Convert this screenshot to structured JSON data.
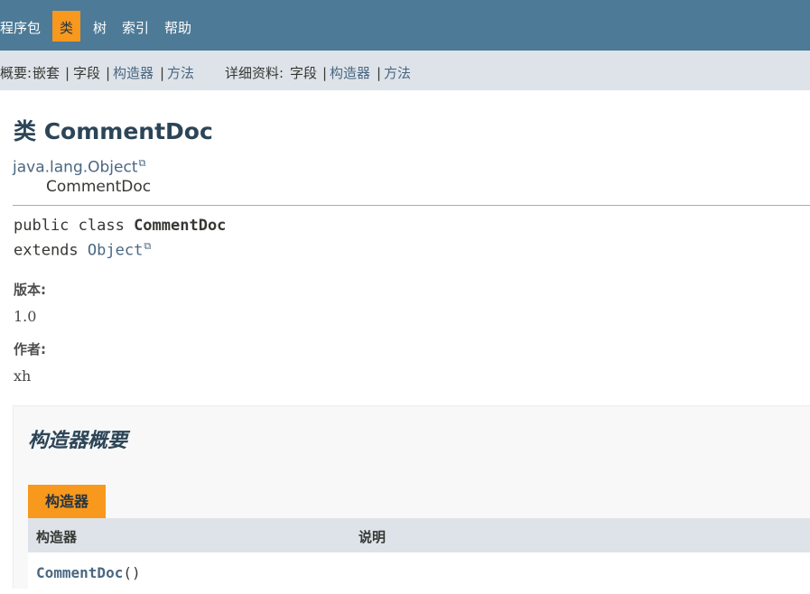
{
  "topnav": {
    "items": [
      "程序包",
      "类",
      "树",
      "索引",
      "帮助"
    ],
    "active": "类"
  },
  "subnav": {
    "summary_label": "概要:",
    "summary_nested": "嵌套",
    "summary_field": "字段",
    "summary_constructor": "构造器",
    "summary_method": "方法",
    "detail_label": "详细资料:",
    "detail_field": "字段",
    "detail_constructor": "构造器",
    "detail_method": "方法",
    "separator": "|"
  },
  "header": {
    "title": "类 CommentDoc"
  },
  "inheritance": {
    "parent": "java.lang.Object",
    "self": "CommentDoc"
  },
  "signature": {
    "line1_prefix": "public class ",
    "class_name": "CommentDoc",
    "line2_prefix": "extends ",
    "superclass": "Object"
  },
  "tags": {
    "version_label": "版本:",
    "version_value": "1.0",
    "author_label": "作者:",
    "author_value": "xh"
  },
  "constructor_summary": {
    "title": "构造器概要",
    "tab_label": "构造器",
    "col_constructor": "构造器",
    "col_description": "说明",
    "rows": [
      {
        "name": "CommentDoc",
        "params": "()",
        "description": ""
      }
    ]
  },
  "colors": {
    "topnav_bg": "#4d7a97",
    "subnav_bg": "#dee3e9",
    "accent_tab": "#f8981d",
    "link": "#4a6782"
  }
}
